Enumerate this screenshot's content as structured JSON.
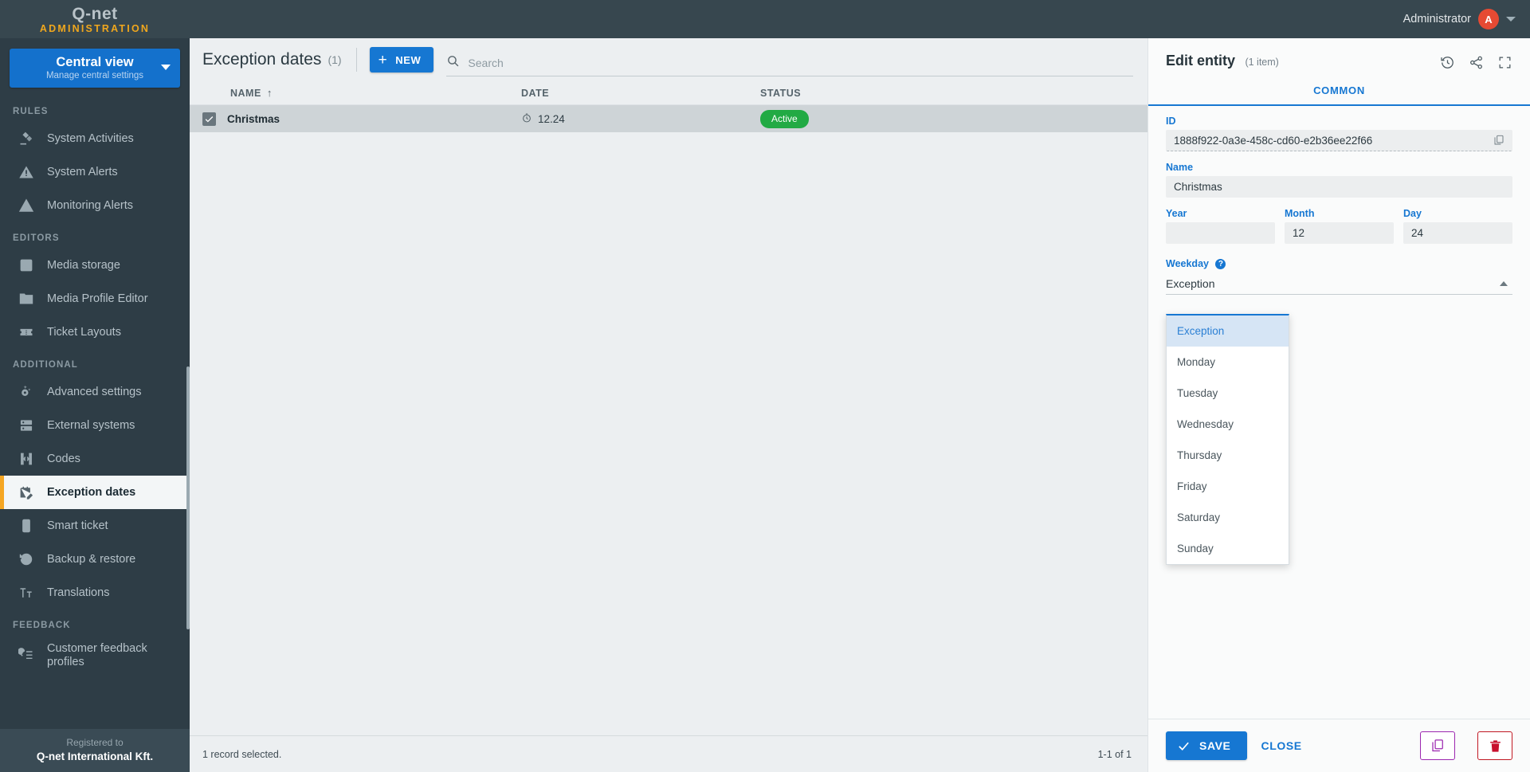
{
  "topbar": {
    "logo": "Q-net",
    "logo_sub": "ADMINISTRATION",
    "user_name": "Administrator",
    "avatar_initial": "A"
  },
  "sidebar": {
    "view_switch": {
      "title": "Central view",
      "subtitle": "Manage central settings"
    },
    "groups": [
      {
        "title": "RULES",
        "items": [
          {
            "label": "System Activities",
            "icon": "gavel-icon",
            "active": false
          },
          {
            "label": "System Alerts",
            "icon": "alert-triangle-filled-icon",
            "active": false
          },
          {
            "label": "Monitoring Alerts",
            "icon": "alert-triangle-outline-icon",
            "active": false
          }
        ]
      },
      {
        "title": "EDITORS",
        "items": [
          {
            "label": "Media storage",
            "icon": "image-icon",
            "active": false
          },
          {
            "label": "Media Profile Editor",
            "icon": "image-folder-icon",
            "active": false
          },
          {
            "label": "Ticket Layouts",
            "icon": "ticket-icon",
            "active": false
          }
        ]
      },
      {
        "title": "ADDITIONAL",
        "items": [
          {
            "label": "Advanced settings",
            "icon": "gear-sparkle-icon",
            "active": false
          },
          {
            "label": "External systems",
            "icon": "server-icon",
            "active": false
          },
          {
            "label": "Codes",
            "icon": "code-brackets-icon",
            "active": false
          },
          {
            "label": "Exception dates",
            "icon": "calendar-edit-icon",
            "active": true
          },
          {
            "label": "Smart ticket",
            "icon": "mobile-icon",
            "active": false
          },
          {
            "label": "Backup & restore",
            "icon": "restore-icon",
            "active": false
          },
          {
            "label": "Translations",
            "icon": "translate-icon",
            "active": false
          }
        ]
      },
      {
        "title": "FEEDBACK",
        "items": [
          {
            "label": "Customer feedback profiles",
            "icon": "feedback-icon",
            "active": false
          }
        ]
      }
    ],
    "registered_label": "Registered to",
    "registered_company": "Q-net International Kft."
  },
  "main": {
    "page_title": "Exception dates",
    "page_count": "(1)",
    "new_button": "NEW",
    "search_placeholder": "Search",
    "search_value": "",
    "columns": [
      "NAME",
      "DATE",
      "STATUS"
    ],
    "sort_column": "NAME",
    "sort_direction": "asc",
    "rows": [
      {
        "name": "Christmas",
        "date": "12.24",
        "status": "Active",
        "selected": true
      }
    ],
    "footer_left": "1 record selected.",
    "footer_right": "1-1 of 1"
  },
  "panel": {
    "title": "Edit entity",
    "title_sub": "(1 item)",
    "tab": "COMMON",
    "fields": {
      "id_label": "ID",
      "id_value": "1888f922-0a3e-458c-cd60-e2b36ee22f66",
      "name_label": "Name",
      "name_value": "Christmas",
      "year_label": "Year",
      "year_value": "",
      "month_label": "Month",
      "month_value": "12",
      "day_label": "Day",
      "day_value": "24",
      "weekday_label": "Weekday",
      "weekday_value": "Exception"
    },
    "weekday_options": [
      {
        "label": "Exception",
        "selected": true
      },
      {
        "label": "Monday",
        "selected": false
      },
      {
        "label": "Tuesday",
        "selected": false
      },
      {
        "label": "Wednesday",
        "selected": false
      },
      {
        "label": "Thursday",
        "selected": false
      },
      {
        "label": "Friday",
        "selected": false
      },
      {
        "label": "Saturday",
        "selected": false
      },
      {
        "label": "Sunday",
        "selected": false
      }
    ],
    "save_label": "SAVE",
    "close_label": "CLOSE"
  },
  "colors": {
    "brand_orange": "#f0a71d",
    "accent_blue": "#1677d2",
    "status_active_green": "#22aa44",
    "sidebar_bg": "#2e3d46",
    "topbar_bg": "#37474f",
    "duplicate_purple": "#9c27b0",
    "delete_red": "#c8102e",
    "avatar_red": "#e64a33"
  }
}
